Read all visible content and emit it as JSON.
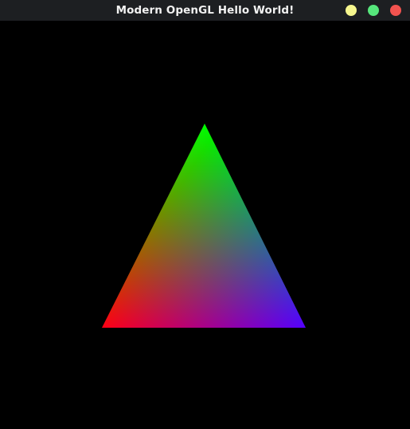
{
  "window": {
    "title": "Modern OpenGL Hello World!",
    "titlebar_color": "#1d1f22",
    "title_color": "#f2f2f2",
    "background_color": "#000000",
    "controls": [
      {
        "name": "minimize",
        "color": "#f6f68e"
      },
      {
        "name": "maximize",
        "color": "#56e67c"
      },
      {
        "name": "close",
        "color": "#f2534f"
      }
    ]
  },
  "scene": {
    "clear_color": "#000000",
    "triangle": {
      "vertex_colors": {
        "top": "#00ff00",
        "bottom_left": "#ff0000",
        "bottom_right": "#0000ff"
      }
    }
  }
}
